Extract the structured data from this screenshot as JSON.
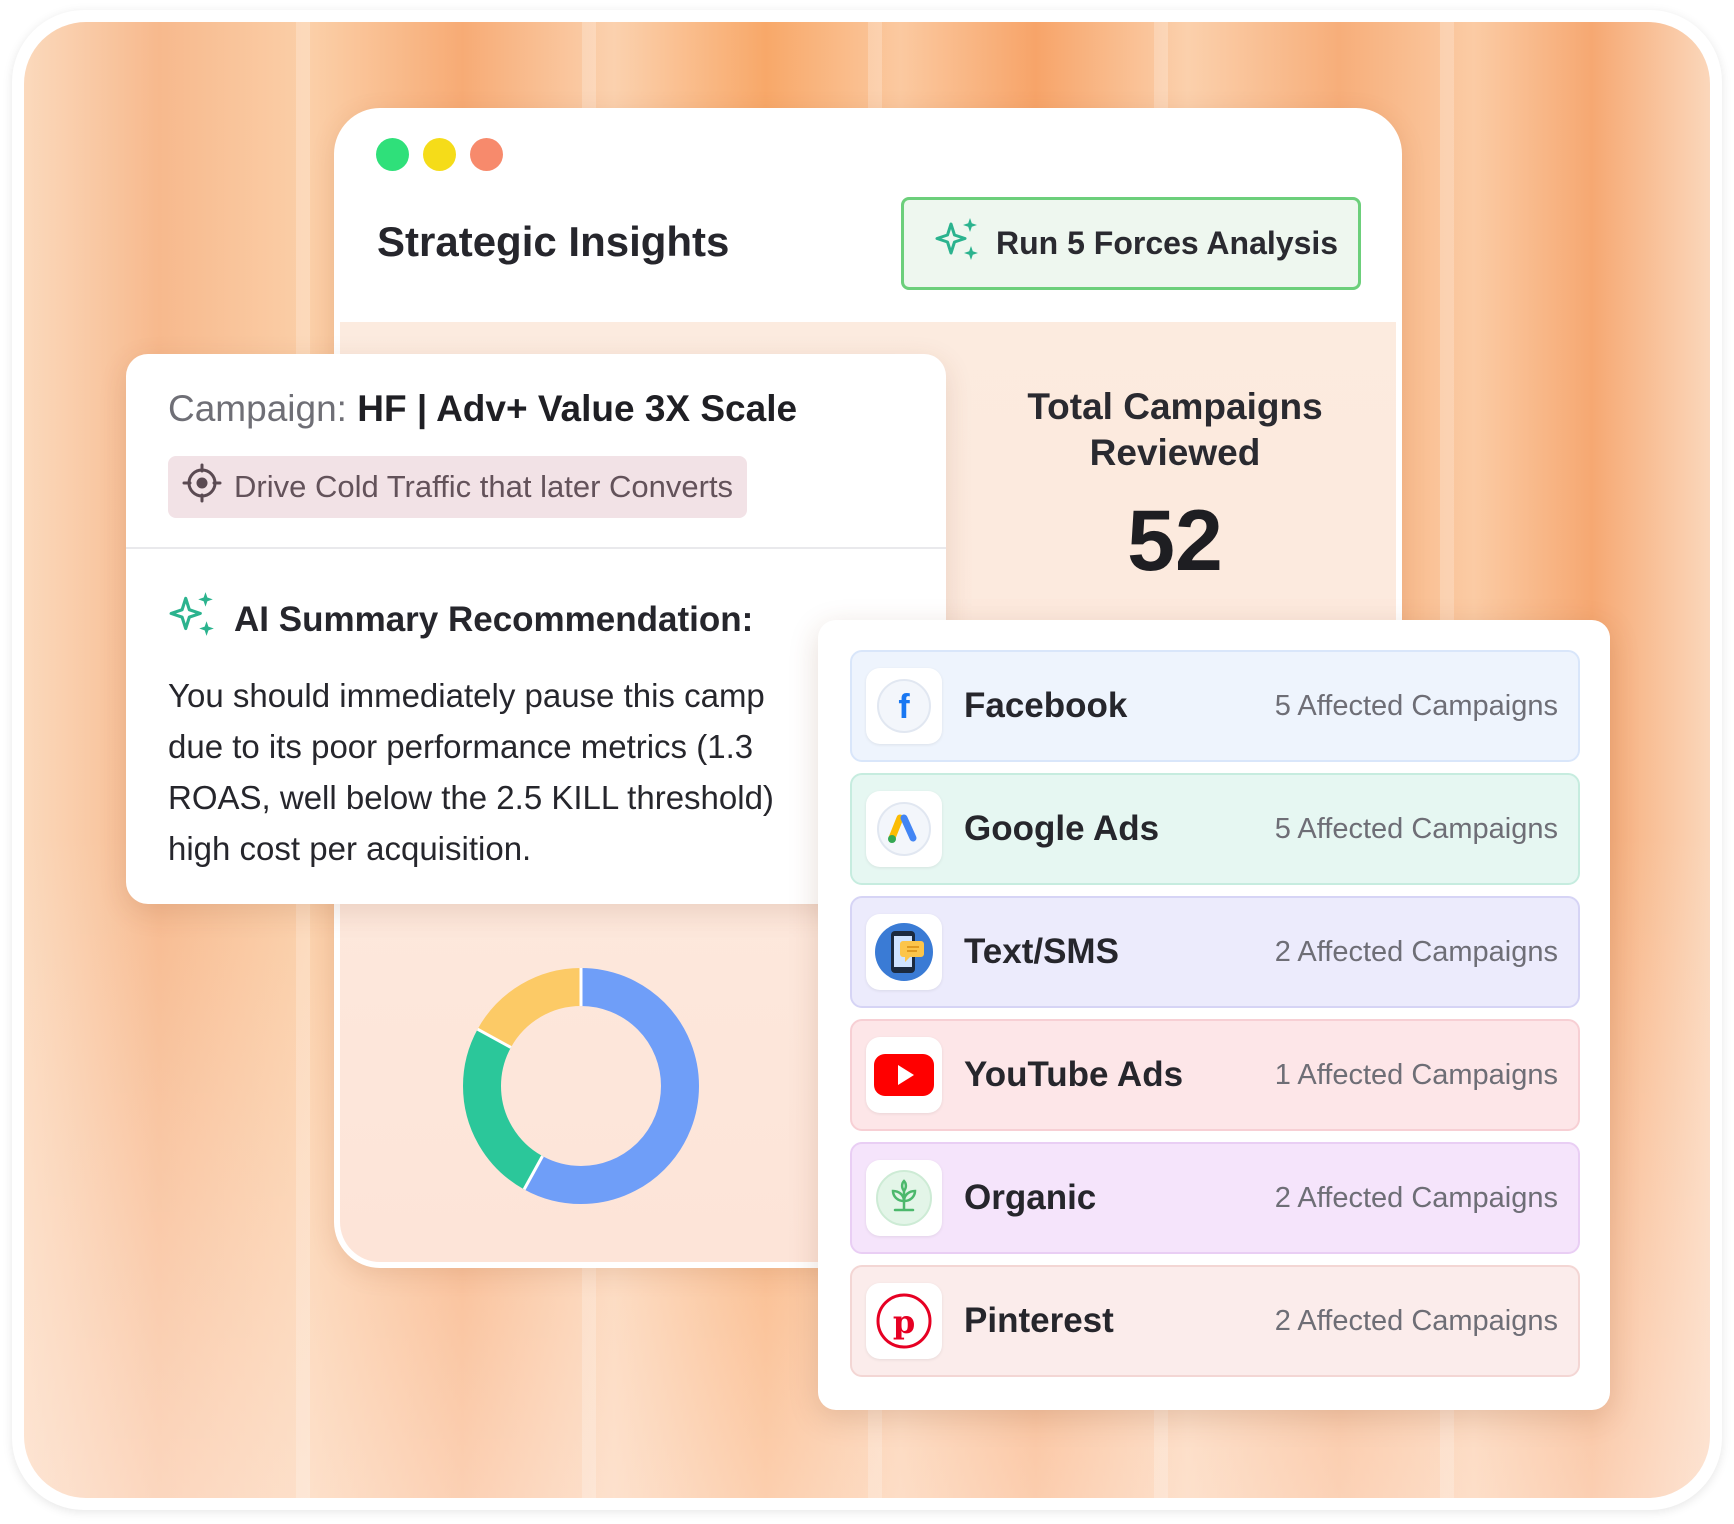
{
  "window": {
    "title": "Strategic Insights",
    "run_button": "Run 5 Forces Analysis"
  },
  "totals": {
    "title": "Total Campaigns Reviewed",
    "value": "52"
  },
  "campaign": {
    "label": "Campaign:",
    "name": "HF | Adv+ Value 3X Scale",
    "objective": "Drive Cold Traffic that later Converts",
    "ai_title": "AI Summary Recommendation:",
    "ai_lines": [
      "You should immediately pause this camp",
      "due to its poor performance metrics (1.3",
      "ROAS, well below the 2.5 KILL threshold)",
      "high cost per acquisition."
    ]
  },
  "chart_data": {
    "type": "pie",
    "values": [
      58,
      25,
      17
    ],
    "colors": [
      "#6f9ef8",
      "#2bc79a",
      "#fcca66"
    ]
  },
  "platforms": [
    {
      "name": "Facebook",
      "count": "5 Affected Campaigns",
      "icon": "facebook-icon",
      "bg": "#eef4fd",
      "border": "#d9e6fa"
    },
    {
      "name": "Google Ads",
      "count": "5 Affected Campaigns",
      "icon": "google-ads-icon",
      "bg": "#e6f7f2",
      "border": "#c6ecdf"
    },
    {
      "name": "Text/SMS",
      "count": "2 Affected Campaigns",
      "icon": "sms-phone-icon",
      "bg": "#ecebfc",
      "border": "#d6d4f5"
    },
    {
      "name": "YouTube Ads",
      "count": "1 Affected Campaigns",
      "icon": "youtube-icon",
      "bg": "#fde6e8",
      "border": "#f7cfd4"
    },
    {
      "name": "Organic",
      "count": "2 Affected Campaigns",
      "icon": "organic-plant-icon",
      "bg": "#f5e4fb",
      "border": "#e9cef4"
    },
    {
      "name": "Pinterest",
      "count": "2 Affected Campaigns",
      "icon": "pinterest-icon",
      "bg": "#fbeceb",
      "border": "#f3d6d4"
    }
  ]
}
